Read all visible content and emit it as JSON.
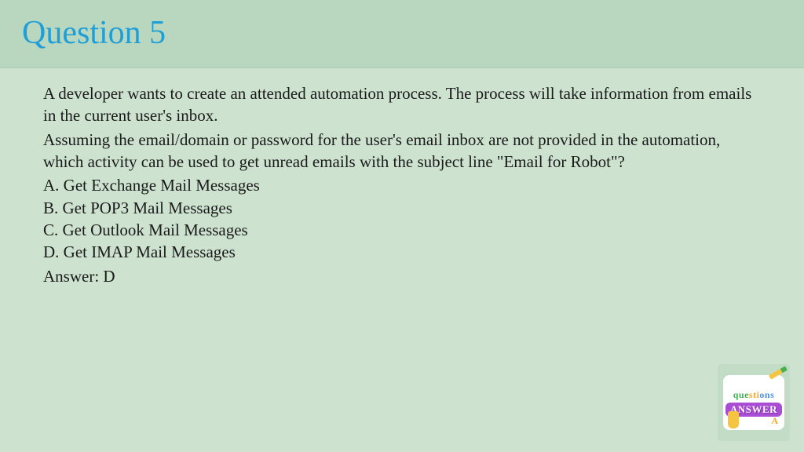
{
  "header": {
    "title": "Question 5"
  },
  "question": {
    "para1": "A developer wants to create an attended automation process. The process will take information from emails in the current user's inbox.",
    "para2": "Assuming the email/domain or password for the user's email inbox are not provided in the automation, which activity can be used to get unread emails with the subject line \"Email for Robot\"?",
    "options": {
      "a": "A. Get Exchange Mail Messages",
      "b": "B. Get POP3 Mail Messages",
      "c": "C. Get Outlook Mail Messages",
      "d": "D. Get IMAP Mail Messages"
    },
    "answer": "Answer: D"
  },
  "logo": {
    "word1": "questions",
    "word2": "ANSWER",
    "aa": "A"
  }
}
